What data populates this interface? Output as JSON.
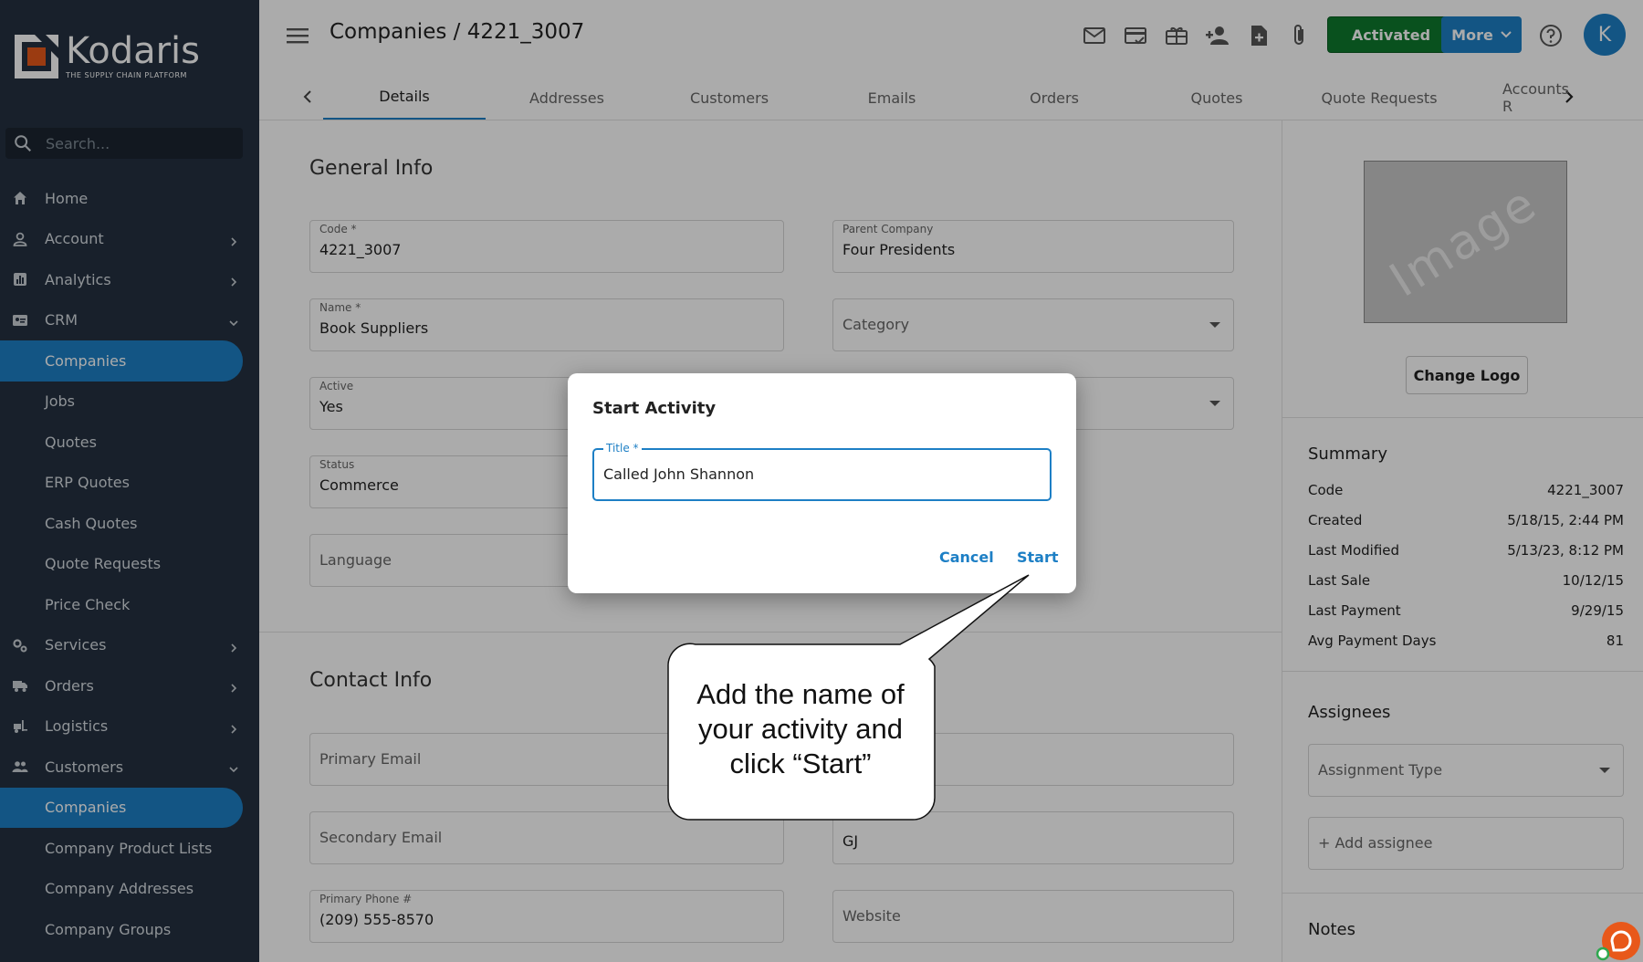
{
  "sidebar": {
    "logo_name": "Kodaris",
    "logo_tagline": "THE SUPPLY CHAIN PLATFORM",
    "search_placeholder": "Search...",
    "items": [
      {
        "label": "Home",
        "icon": "home-icon",
        "chevron": "",
        "active": false
      },
      {
        "label": "Account",
        "icon": "person-icon",
        "chevron": "right",
        "active": false
      },
      {
        "label": "Analytics",
        "icon": "chart-icon",
        "chevron": "right",
        "active": false
      },
      {
        "label": "CRM",
        "icon": "contact-card-icon",
        "chevron": "down",
        "active": false
      },
      {
        "label": "Companies",
        "icon": "",
        "chevron": "",
        "active": true
      },
      {
        "label": "Jobs",
        "icon": "",
        "chevron": "",
        "active": false
      },
      {
        "label": "Quotes",
        "icon": "",
        "chevron": "",
        "active": false
      },
      {
        "label": "ERP Quotes",
        "icon": "",
        "chevron": "",
        "active": false
      },
      {
        "label": "Cash Quotes",
        "icon": "",
        "chevron": "",
        "active": false
      },
      {
        "label": "Quote Requests",
        "icon": "",
        "chevron": "",
        "active": false
      },
      {
        "label": "Price Check",
        "icon": "",
        "chevron": "",
        "active": false
      },
      {
        "label": "Services",
        "icon": "gears-icon",
        "chevron": "right",
        "active": false
      },
      {
        "label": "Orders",
        "icon": "truck-icon",
        "chevron": "right",
        "active": false
      },
      {
        "label": "Logistics",
        "icon": "forklift-icon",
        "chevron": "right",
        "active": false
      },
      {
        "label": "Customers",
        "icon": "people-icon",
        "chevron": "down",
        "active": false
      },
      {
        "label": "Companies",
        "icon": "",
        "chevron": "",
        "active": true
      },
      {
        "label": "Company Product Lists",
        "icon": "",
        "chevron": "",
        "active": false
      },
      {
        "label": "Company Addresses",
        "icon": "",
        "chevron": "",
        "active": false
      },
      {
        "label": "Company Groups",
        "icon": "",
        "chevron": "",
        "active": false
      }
    ]
  },
  "header": {
    "title": "Companies / 4221_3007",
    "activated_label": "Activated",
    "more_label": "More",
    "avatar_initial": "K"
  },
  "tabs": [
    "Details",
    "Addresses",
    "Customers",
    "Emails",
    "Orders",
    "Quotes",
    "Quote Requests",
    "Accounts R"
  ],
  "general_info": {
    "title": "General Info",
    "code_label": "Code *",
    "code_value": "4221_3007",
    "parent_label": "Parent Company",
    "parent_value": "Four Presidents",
    "name_label": "Name *",
    "name_value": "Book Suppliers",
    "category_placeholder": "Category",
    "active_label": "Active",
    "active_value": "Yes",
    "status_label": "Status",
    "status_value": "Commerce",
    "language_placeholder": "Language"
  },
  "contact_info": {
    "title": "Contact Info",
    "primary_email_placeholder": "Primary Email",
    "secondary_email_placeholder": "Secondary Email",
    "sales_rep_value": "GJ",
    "primary_phone_label": "Primary Phone #",
    "primary_phone_value": "(209) 555-8570",
    "website_placeholder": "Website"
  },
  "right_panel": {
    "image_placeholder": "Image",
    "change_logo_label": "Change Logo",
    "summary_title": "Summary",
    "summary": [
      {
        "key": "Code",
        "value": "4221_3007"
      },
      {
        "key": "Created",
        "value": "5/18/15, 2:44 PM"
      },
      {
        "key": "Last Modified",
        "value": "5/13/23, 8:12 PM"
      },
      {
        "key": "Last Sale",
        "value": "10/12/15"
      },
      {
        "key": "Last Payment",
        "value": "9/29/15"
      },
      {
        "key": "Avg Payment Days",
        "value": "81"
      }
    ],
    "assignees_title": "Assignees",
    "assignment_type_placeholder": "Assignment Type",
    "add_assignee_label": "+ Add assignee",
    "notes_title": "Notes"
  },
  "dialog": {
    "title": "Start Activity",
    "field_label": "Title *",
    "field_value": "Called John Shannon",
    "cancel_label": "Cancel",
    "start_label": "Start"
  },
  "callout": {
    "text": "Add the name of your activity and click “Start”"
  },
  "colors": {
    "sidebar_bg": "#243140",
    "accent": "#1d7fc5",
    "activated_green": "#0e7a2e",
    "chat_orange": "#e8581a"
  }
}
